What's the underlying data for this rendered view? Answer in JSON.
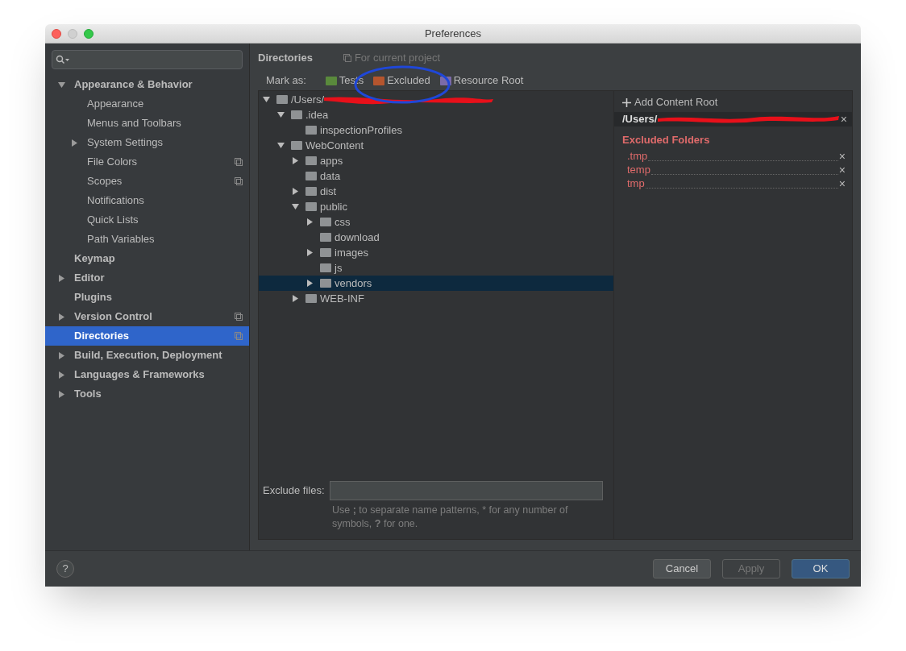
{
  "window": {
    "title": "Preferences"
  },
  "sidebar": {
    "items": [
      {
        "label": "Appearance & Behavior",
        "selected": false,
        "expanded": true,
        "children": [
          {
            "label": "Appearance",
            "selected": false
          },
          {
            "label": "Menus and Toolbars",
            "selected": false
          },
          {
            "label": "System Settings",
            "selected": false,
            "expanded": false
          },
          {
            "label": "File Colors",
            "selected": false,
            "project": true
          },
          {
            "label": "Scopes",
            "selected": false,
            "project": true
          },
          {
            "label": "Notifications",
            "selected": false
          },
          {
            "label": "Quick Lists",
            "selected": false
          },
          {
            "label": "Path Variables",
            "selected": false
          }
        ]
      },
      {
        "label": "Keymap",
        "selected": false
      },
      {
        "label": "Editor",
        "selected": false,
        "expanded": false
      },
      {
        "label": "Plugins",
        "selected": false
      },
      {
        "label": "Version Control",
        "selected": false,
        "expanded": false,
        "project": true
      },
      {
        "label": "Directories",
        "selected": true,
        "project": true
      },
      {
        "label": "Build, Execution, Deployment",
        "selected": false,
        "expanded": false
      },
      {
        "label": "Languages & Frameworks",
        "selected": false,
        "expanded": false
      },
      {
        "label": "Tools",
        "selected": false,
        "expanded": false
      }
    ]
  },
  "header": {
    "title": "Directories",
    "scope": "For current project"
  },
  "mark_as": {
    "label": "Mark as:",
    "options": [
      {
        "label": "Tests",
        "color": "#5a8a3c"
      },
      {
        "label": "Excluded",
        "color": "#b5552e"
      },
      {
        "label": "Resource Root",
        "color": "#7b6ba8"
      }
    ]
  },
  "tree": [
    {
      "label": "/Users/",
      "redacted": true,
      "selected": false,
      "expanded": true,
      "children": [
        {
          "label": ".idea",
          "selected": false,
          "expanded": true,
          "children": [
            {
              "label": "inspectionProfiles",
              "selected": false
            }
          ]
        },
        {
          "label": "WebContent",
          "selected": false,
          "expanded": true,
          "children": [
            {
              "label": "apps",
              "selected": false,
              "expanded": false
            },
            {
              "label": "data",
              "selected": false
            },
            {
              "label": "dist",
              "selected": false,
              "expanded": false
            },
            {
              "label": "public",
              "selected": false,
              "expanded": true,
              "children": [
                {
                  "label": "css",
                  "selected": false,
                  "expanded": false
                },
                {
                  "label": "download",
                  "selected": false
                },
                {
                  "label": "images",
                  "selected": false,
                  "expanded": false
                },
                {
                  "label": "js",
                  "selected": false
                },
                {
                  "label": "vendors",
                  "selected": true,
                  "expanded": false
                }
              ]
            },
            {
              "label": "WEB-INF",
              "selected": false,
              "expanded": false
            }
          ]
        }
      ]
    }
  ],
  "exclude_files": {
    "label": "Exclude files:",
    "hint": "Use **;** to separate name patterns, * for any number of symbols, **?** for one."
  },
  "content_root": {
    "add_label": "Add Content Root",
    "path": "/Users/",
    "excluded_title": "Excluded Folders",
    "remove_glyph": "×",
    "excluded": [
      {
        "name": ".tmp",
        "remove_glyph": "×"
      },
      {
        "name": "temp",
        "remove_glyph": "×"
      },
      {
        "name": "tmp",
        "remove_glyph": "×"
      }
    ]
  },
  "help_button": "?",
  "buttons": [
    {
      "label": "Cancel",
      "kind": "normal"
    },
    {
      "label": "Apply",
      "kind": "disabled"
    },
    {
      "label": "OK",
      "kind": "default"
    }
  ]
}
